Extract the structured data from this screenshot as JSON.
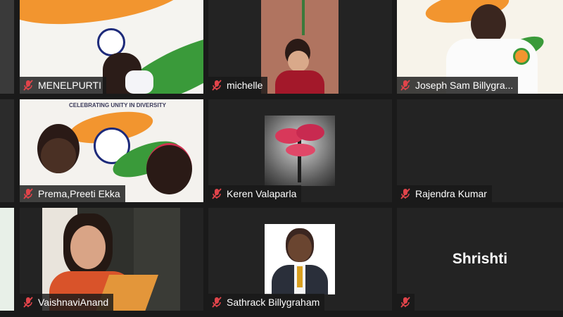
{
  "participants": [
    {
      "name": "MENELPURTI",
      "muted": true
    },
    {
      "name": "michelle",
      "muted": true
    },
    {
      "name": "Joseph Sam Billygra...",
      "muted": true
    },
    {
      "name": "Prema,Preeti Ekka",
      "muted": true
    },
    {
      "name": "Keren Valaparla",
      "muted": true
    },
    {
      "name": "Rajendra Kumar",
      "muted": true
    },
    {
      "name": "VaishnaviAnand",
      "muted": true
    },
    {
      "name": "Sathrack Billygraham",
      "muted": true
    },
    {
      "name": "",
      "muted": true,
      "center_label": "Shrishti"
    }
  ],
  "banner_text": "CELEBRATING UNITY IN DIVERSITY",
  "colors": {
    "muted_icon": "#e0444a",
    "tile_bg": "#232323",
    "background": "#1a1a1a"
  },
  "icons": {
    "muted": "microphone-muted-icon"
  }
}
